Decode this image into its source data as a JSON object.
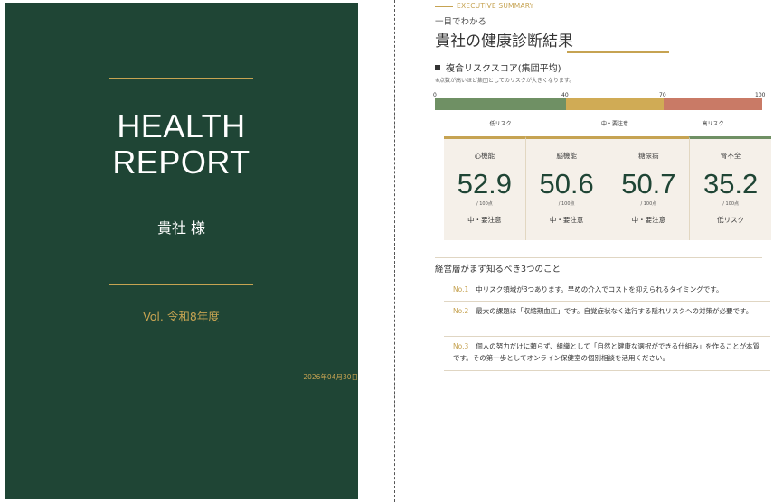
{
  "cover": {
    "title_line1": "HEALTH",
    "title_line2": "REPORT",
    "client": "貴社 様",
    "volume": "Vol.  令和8年度",
    "date": "2026年04月30日",
    "background_color": "#1f4535",
    "accent_color": "#c6a352"
  },
  "summary": {
    "eyebrow": "EXECUTIVE SUMMARY",
    "subtitle": "一目でわかる",
    "title": "貴社の健康診断結果",
    "risk_section": {
      "heading": "複合リスクスコア(集団平均)",
      "note": "※点数が高いほど集団としてのリスクが大きくなります。",
      "scale": {
        "ticks": [
          "0",
          "40",
          "70",
          "100"
        ],
        "bands": [
          {
            "label": "低リスク",
            "from": 0,
            "to": 40,
            "color": "#6f9064"
          },
          {
            "label": "中・要注意",
            "from": 40,
            "to": 70,
            "color": "#d0ab55"
          },
          {
            "label": "高リスク",
            "from": 70,
            "to": 100,
            "color": "#c97a66"
          }
        ]
      },
      "cards": [
        {
          "name": "心機能",
          "value": "52.9",
          "unit": "/ 100点",
          "level": "中・要注意",
          "color": "#c6a352"
        },
        {
          "name": "脳機能",
          "value": "50.6",
          "unit": "/ 100点",
          "level": "中・要注意",
          "color": "#c6a352"
        },
        {
          "name": "糖尿病",
          "value": "50.7",
          "unit": "/ 100点",
          "level": "中・要注意",
          "color": "#c6a352"
        },
        {
          "name": "腎不全",
          "value": "35.2",
          "unit": "/ 100点",
          "level": "低リスク",
          "color": "#6f9064"
        }
      ]
    },
    "exec_section": {
      "heading": "経営層がまず知るべき3つのこと",
      "points": [
        {
          "no": "No.1",
          "text": "中リスク領域が3つあります。早めの介入でコストを抑えられるタイミングです。"
        },
        {
          "no": "No.2",
          "text": "最大の課題は「収縮期血圧」です。自覚症状なく進行する隠れリスクへの対策が必要です。"
        },
        {
          "no": "No.3",
          "text": "個人の努力だけに頼らず、組織として「自然と健康な選択ができる仕組み」を作ることが本質です。その第一歩としてオンライン保健室の個別相談を活用ください。"
        }
      ]
    }
  }
}
